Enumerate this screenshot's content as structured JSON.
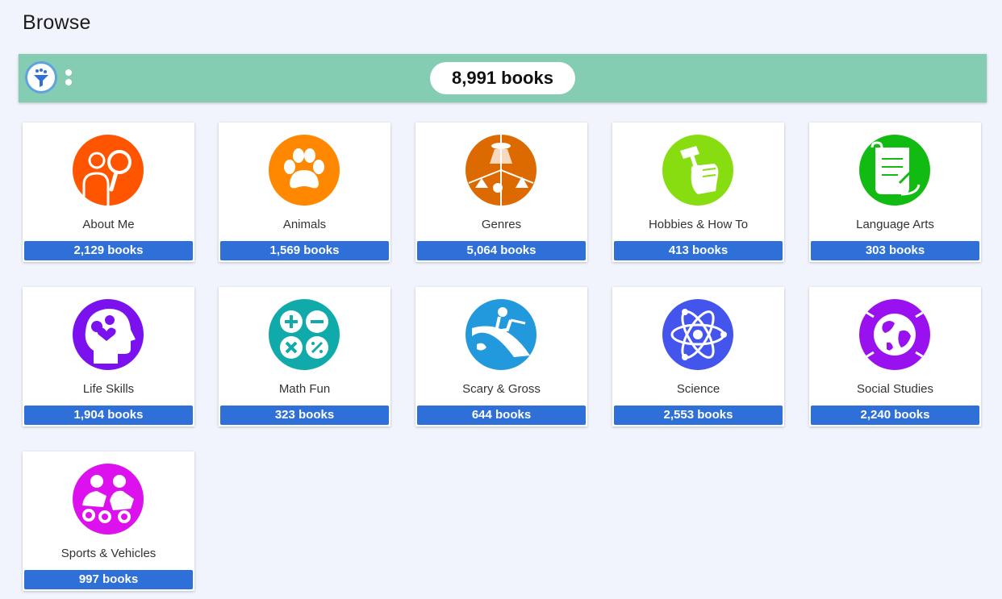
{
  "page": {
    "title": "Browse"
  },
  "toolbar": {
    "total_label": "8,991 books",
    "background": "#84cdb2"
  },
  "categories": [
    {
      "name": "About Me",
      "count": "2,129 books",
      "icon": "person-magnifier-icon",
      "color": "#ff5500"
    },
    {
      "name": "Animals",
      "count": "1,569 books",
      "icon": "paw-icon",
      "color": "#ff8800"
    },
    {
      "name": "Genres",
      "count": "5,064 books",
      "icon": "genres-collage-icon",
      "color": "#dd6a00"
    },
    {
      "name": "Hobbies & How To",
      "count": "413 books",
      "icon": "hammer-fist-icon",
      "color": "#88dd11"
    },
    {
      "name": "Language Arts",
      "count": "303 books",
      "icon": "scroll-quill-icon",
      "color": "#11bb11"
    },
    {
      "name": "Life Skills",
      "count": "1,904 books",
      "icon": "head-gears-heart-icon",
      "color": "#7a11ee"
    },
    {
      "name": "Math Fun",
      "count": "323 books",
      "icon": "math-symbols-icon",
      "color": "#11aaaa"
    },
    {
      "name": "Scary & Gross",
      "count": "644 books",
      "icon": "slide-kid-icon",
      "color": "#2299dd"
    },
    {
      "name": "Science",
      "count": "2,553 books",
      "icon": "atom-icon",
      "color": "#4455ee"
    },
    {
      "name": "Social Studies",
      "count": "2,240 books",
      "icon": "globe-icon",
      "color": "#9911ee"
    },
    {
      "name": "Sports & Vehicles",
      "count": "997 books",
      "icon": "go-kart-racers-icon",
      "color": "#dd11ee"
    }
  ]
}
